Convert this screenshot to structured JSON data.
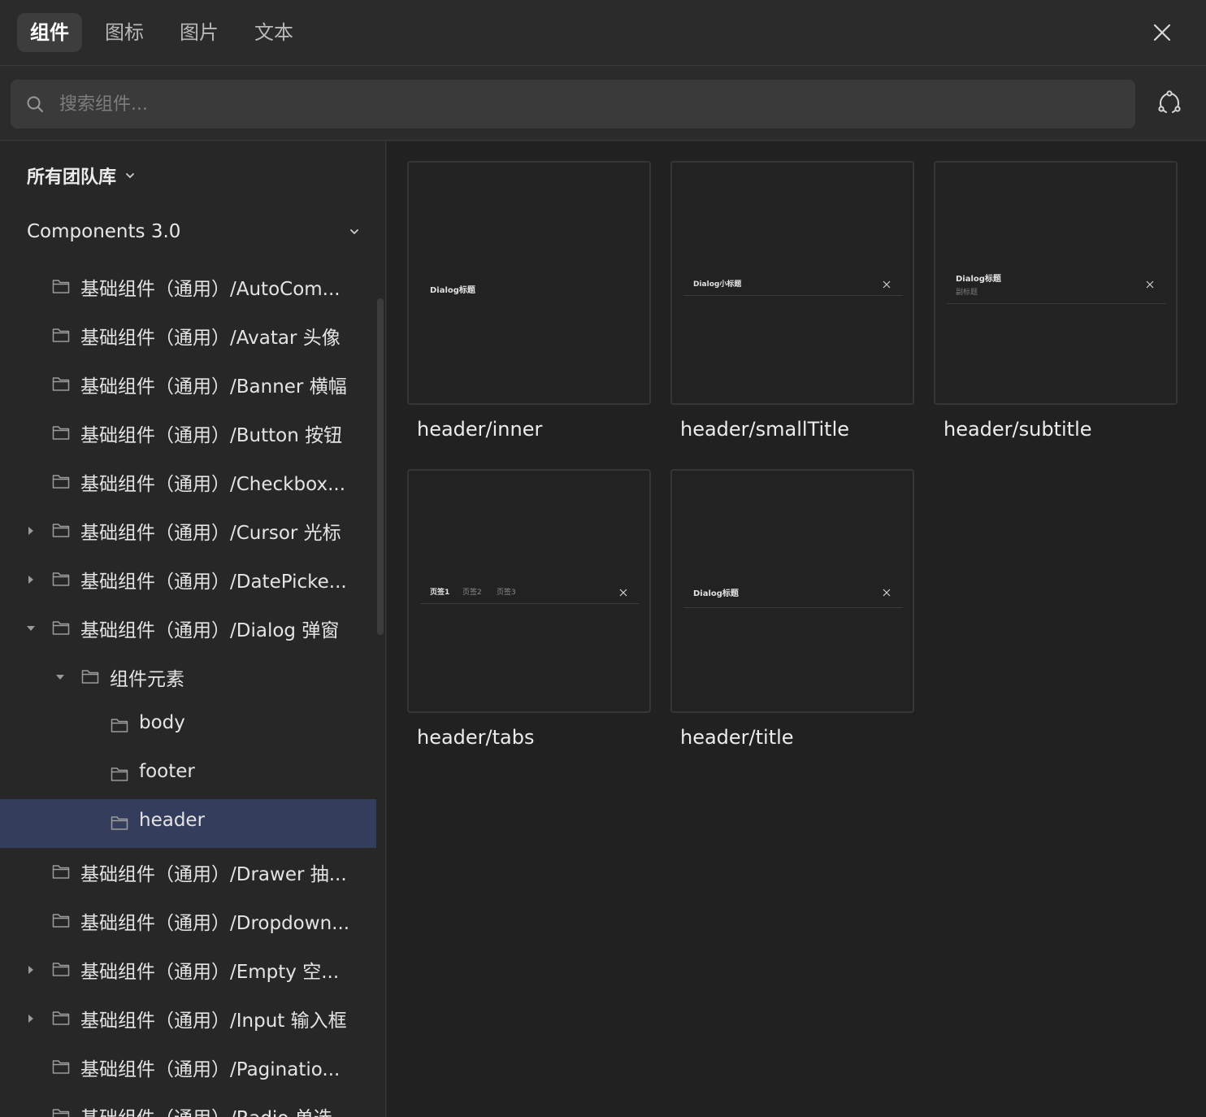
{
  "tabs": [
    {
      "label": "组件",
      "active": true
    },
    {
      "label": "图标",
      "active": false
    },
    {
      "label": "图片",
      "active": false
    },
    {
      "label": "文本",
      "active": false
    }
  ],
  "search": {
    "placeholder": "搜索组件..."
  },
  "sidebar": {
    "library_select": "所有团队库",
    "library_name": "Components 3.0",
    "items": [
      {
        "label": "基础组件（通用）/AutoCom...",
        "expand": "none"
      },
      {
        "label": "基础组件（通用）/Avatar 头像",
        "expand": "none"
      },
      {
        "label": "基础组件（通用）/Banner 横幅",
        "expand": "none"
      },
      {
        "label": "基础组件（通用）/Button 按钮",
        "expand": "none"
      },
      {
        "label": "基础组件（通用）/Checkbox...",
        "expand": "none"
      },
      {
        "label": "基础组件（通用）/Cursor 光标",
        "expand": "collapsed"
      },
      {
        "label": "基础组件（通用）/DatePicke...",
        "expand": "collapsed"
      },
      {
        "label": "基础组件（通用）/Dialog 弹窗",
        "expand": "expanded"
      },
      {
        "label": "组件元素",
        "expand": "expanded"
      },
      {
        "label": "body",
        "expand": "none"
      },
      {
        "label": "footer",
        "expand": "none"
      },
      {
        "label": "header",
        "expand": "none",
        "selected": true
      },
      {
        "label": "基础组件（通用）/Drawer 抽...",
        "expand": "none"
      },
      {
        "label": "基础组件（通用）/Dropdown...",
        "expand": "none"
      },
      {
        "label": "基础组件（通用）/Empty 空...",
        "expand": "collapsed"
      },
      {
        "label": "基础组件（通用）/Input 输入框",
        "expand": "collapsed"
      },
      {
        "label": "基础组件（通用）/Paginatio...",
        "expand": "none"
      },
      {
        "label": "基础组件（通用）/Radio 单选",
        "expand": "none"
      }
    ]
  },
  "cards": [
    {
      "name": "header/inner",
      "preview": {
        "title": "Dialog标题"
      }
    },
    {
      "name": "header/smallTitle",
      "preview": {
        "title": "Dialog小标题"
      }
    },
    {
      "name": "header/subtitle",
      "preview": {
        "title": "Dialog标题",
        "subtitle": "副标题"
      }
    },
    {
      "name": "header/tabs",
      "preview": {
        "tab1": "页签1",
        "tab2": "页签2",
        "tab3": "页签3"
      }
    },
    {
      "name": "header/title",
      "preview": {
        "title": "Dialog标题"
      }
    }
  ],
  "colors": {
    "selected_row": "#353d5c",
    "background": "#2b2b2b",
    "grid_background": "#212121"
  },
  "icons": {
    "close": "close-icon",
    "search": "search-icon",
    "community": "community-icon",
    "folder": "folder-icon",
    "chevron": "chevron-down-icon",
    "caret_right": "caret-right-icon",
    "caret_down": "caret-down-icon"
  }
}
